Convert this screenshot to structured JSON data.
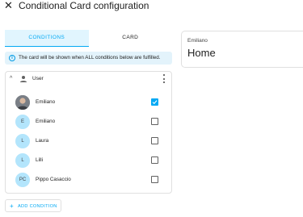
{
  "dialog": {
    "title": "Conditional Card configuration",
    "close_icon": "close-icon"
  },
  "tabs": [
    {
      "label": "Conditions",
      "active": true
    },
    {
      "label": "Card",
      "active": false
    }
  ],
  "info": {
    "icon": "info-icon",
    "text": "The card will be shown when ALL conditions below are fulfilled."
  },
  "condition": {
    "label": "User",
    "icon": "account-icon",
    "users": [
      {
        "name": "Emiliano",
        "initials": "",
        "has_photo": true,
        "checked": true
      },
      {
        "name": "Emiliano",
        "initials": "E",
        "has_photo": false,
        "checked": false
      },
      {
        "name": "Laura",
        "initials": "L",
        "has_photo": false,
        "checked": false
      },
      {
        "name": "Lilli",
        "initials": "L",
        "has_photo": false,
        "checked": false
      },
      {
        "name": "Pippo Casaccio",
        "initials": "PC",
        "has_photo": false,
        "checked": false
      }
    ]
  },
  "add_condition": {
    "label": "Add condition"
  },
  "preview": {
    "name": "Emiliano",
    "state": "Home"
  },
  "colors": {
    "accent": "#03a9f4",
    "avatar_bg": "#b3e5fc",
    "info_bg": "#e3f3fb"
  }
}
